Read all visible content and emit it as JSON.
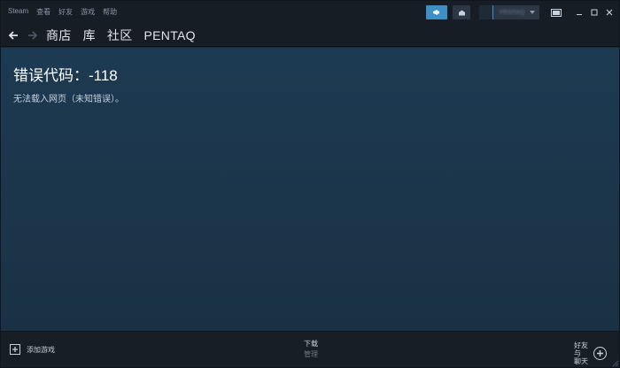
{
  "menu": [
    "Steam",
    "查看",
    "好友",
    "游戏",
    "帮助"
  ],
  "account": {
    "name": "PENTAQ"
  },
  "nav": {
    "links": [
      "商店",
      "库",
      "社区",
      "PENTAQ"
    ]
  },
  "error": {
    "title": "错误代码：-118",
    "message": "无法载入网页（未知错误）。"
  },
  "bottom": {
    "add_game": "添加游戏",
    "downloads": "下载",
    "downloads_sub": "管理",
    "friends_line1": "好友与",
    "friends_line2": "聊天"
  },
  "colors": {
    "accent": "#3d8fc4",
    "titlebar": "#171d25",
    "content": "#1b3349"
  }
}
